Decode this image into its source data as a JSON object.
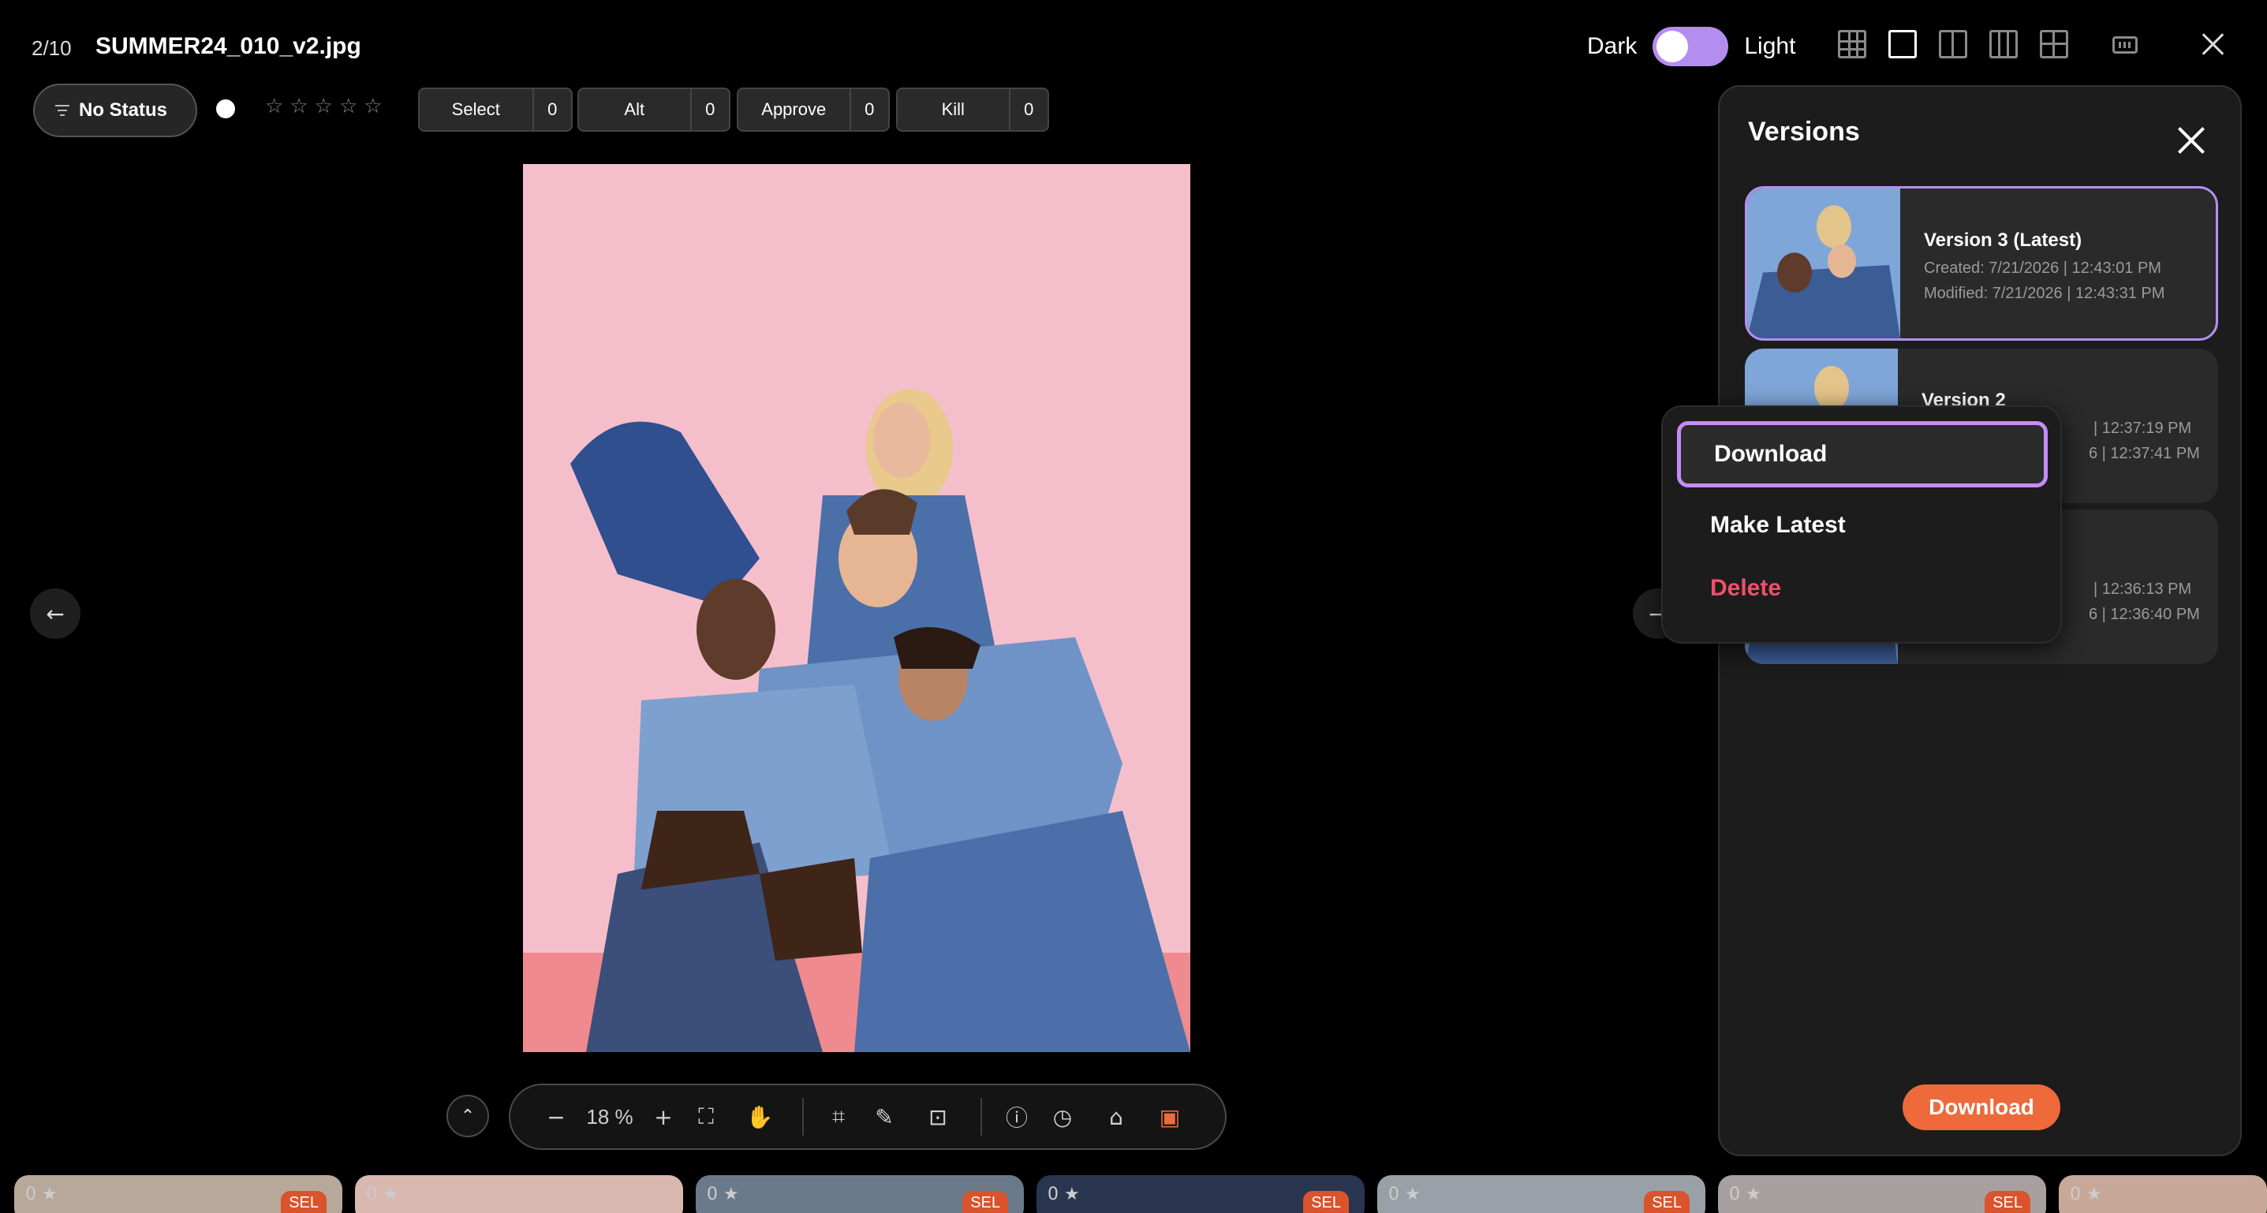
{
  "header": {
    "counter": "2/10",
    "filename": "SUMMER24_010_v2.jpg",
    "theme_dark": "Dark",
    "theme_light": "Light"
  },
  "status": {
    "label": "No Status",
    "rating": 0,
    "rating_max": 5
  },
  "counters": [
    {
      "label": "Select",
      "count": "0"
    },
    {
      "label": "Alt",
      "count": "0"
    },
    {
      "label": "Approve",
      "count": "0"
    },
    {
      "label": "Kill",
      "count": "0"
    }
  ],
  "toolbar": {
    "zoom_minus": "−",
    "zoom_value": "18 %",
    "zoom_plus": "+"
  },
  "versions": {
    "title": "Versions",
    "items": [
      {
        "title": "Version 3 (Latest)",
        "created": "Created: 7/21/2026 | 12:43:01 PM",
        "modified": "Modified: 7/21/2026 | 12:43:31 PM"
      },
      {
        "title": "Version 2",
        "created": "| 12:37:19 PM",
        "modified": "6 | 12:37:41 PM"
      },
      {
        "title": "",
        "created": "| 12:36:13 PM",
        "modified": "6 | 12:36:40 PM"
      }
    ],
    "download_label": "Download"
  },
  "context_menu": {
    "items": [
      "Download",
      "Make Latest",
      "Delete"
    ]
  },
  "filmstrip": [
    {
      "count": "0",
      "badge": "SEL"
    },
    {
      "count": "0",
      "badge": ""
    },
    {
      "count": "0",
      "badge": "SEL"
    },
    {
      "count": "0",
      "badge": "SEL"
    },
    {
      "count": "0",
      "badge": "SEL"
    },
    {
      "count": "0",
      "badge": "SEL"
    },
    {
      "count": "0",
      "badge": ""
    }
  ],
  "colors": {
    "accent": "#b38ef0",
    "download": "#ee6a3a",
    "danger": "#ef4f6c",
    "badge": "#d9542c"
  }
}
